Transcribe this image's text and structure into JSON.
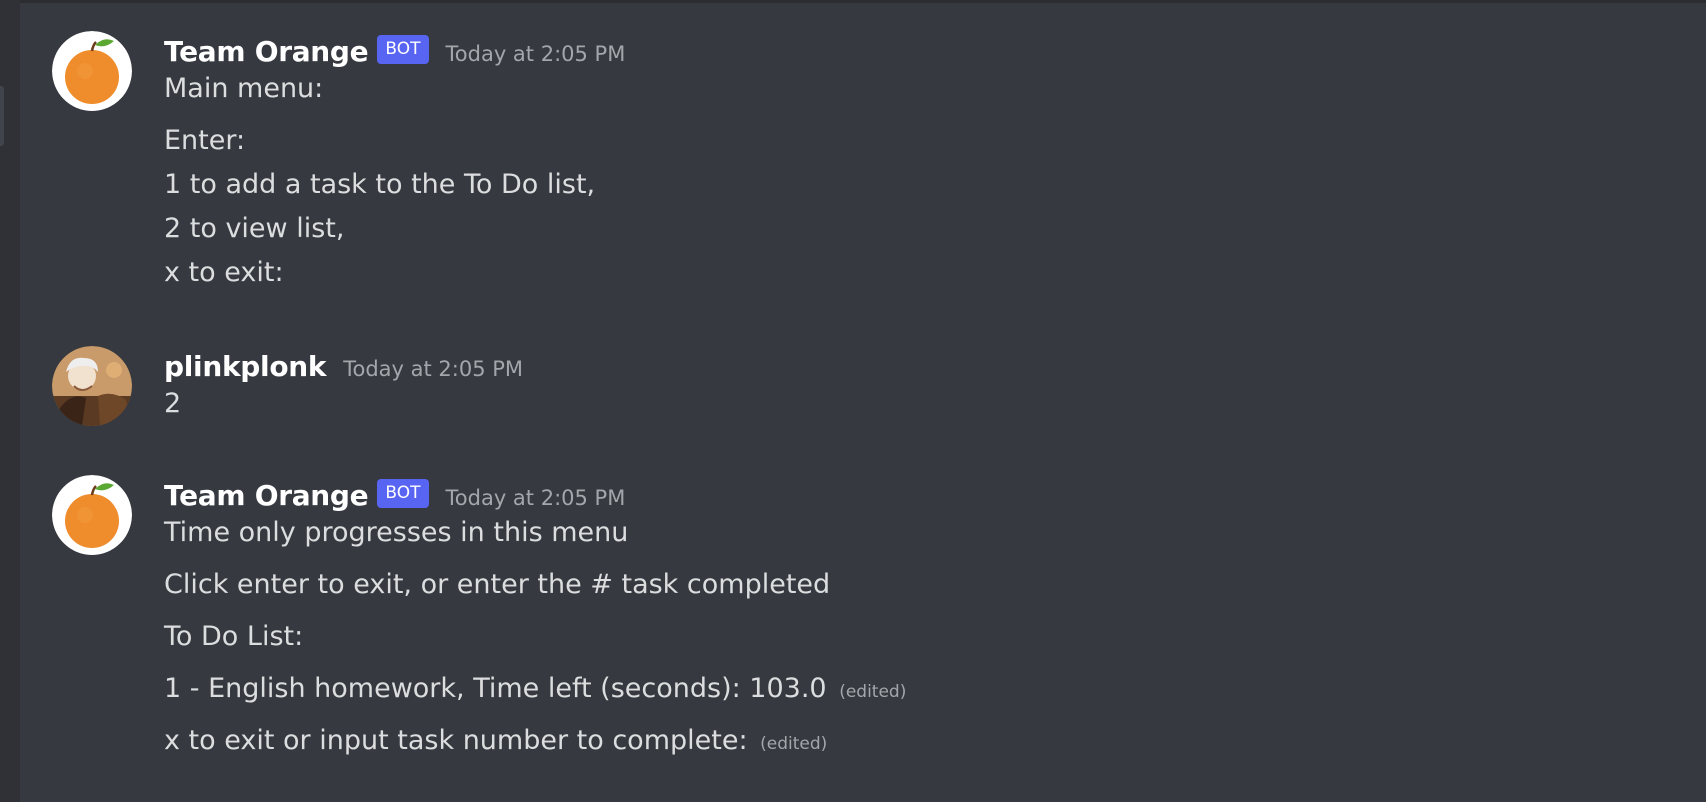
{
  "bot_user": {
    "name": "Team Orange",
    "tag": "BOT"
  },
  "messages": [
    {
      "author": "Team Orange",
      "tag": "BOT",
      "timestamp": "Today at 2:05 PM",
      "lines": [
        "Main menu:",
        "Enter:",
        "1 to add a task to the To Do list,",
        "2 to view list,",
        "x to exit:"
      ]
    },
    {
      "author": "plinkplonk",
      "timestamp": "Today at 2:05 PM",
      "lines": [
        "2"
      ]
    },
    {
      "author": "Team Orange",
      "tag": "BOT",
      "timestamp": "Today at 2:05 PM",
      "lines": [
        "Time only progresses in this menu",
        "Click enter to exit, or enter the # task completed",
        "To Do List:",
        "1 - English homework, Time left (seconds): 103.0",
        "x to exit or input task number to complete:"
      ],
      "edited_label": "(edited)"
    }
  ],
  "colors": {
    "background": "#36393f",
    "username": "#ffffff",
    "message_text": "#dcddde",
    "timestamp": "#a3a6aa",
    "bot_tag": "#5865f2"
  },
  "icons": {
    "bot_avatar": "orange-avatar-icon",
    "user_avatar": "anime-character-avatar"
  }
}
